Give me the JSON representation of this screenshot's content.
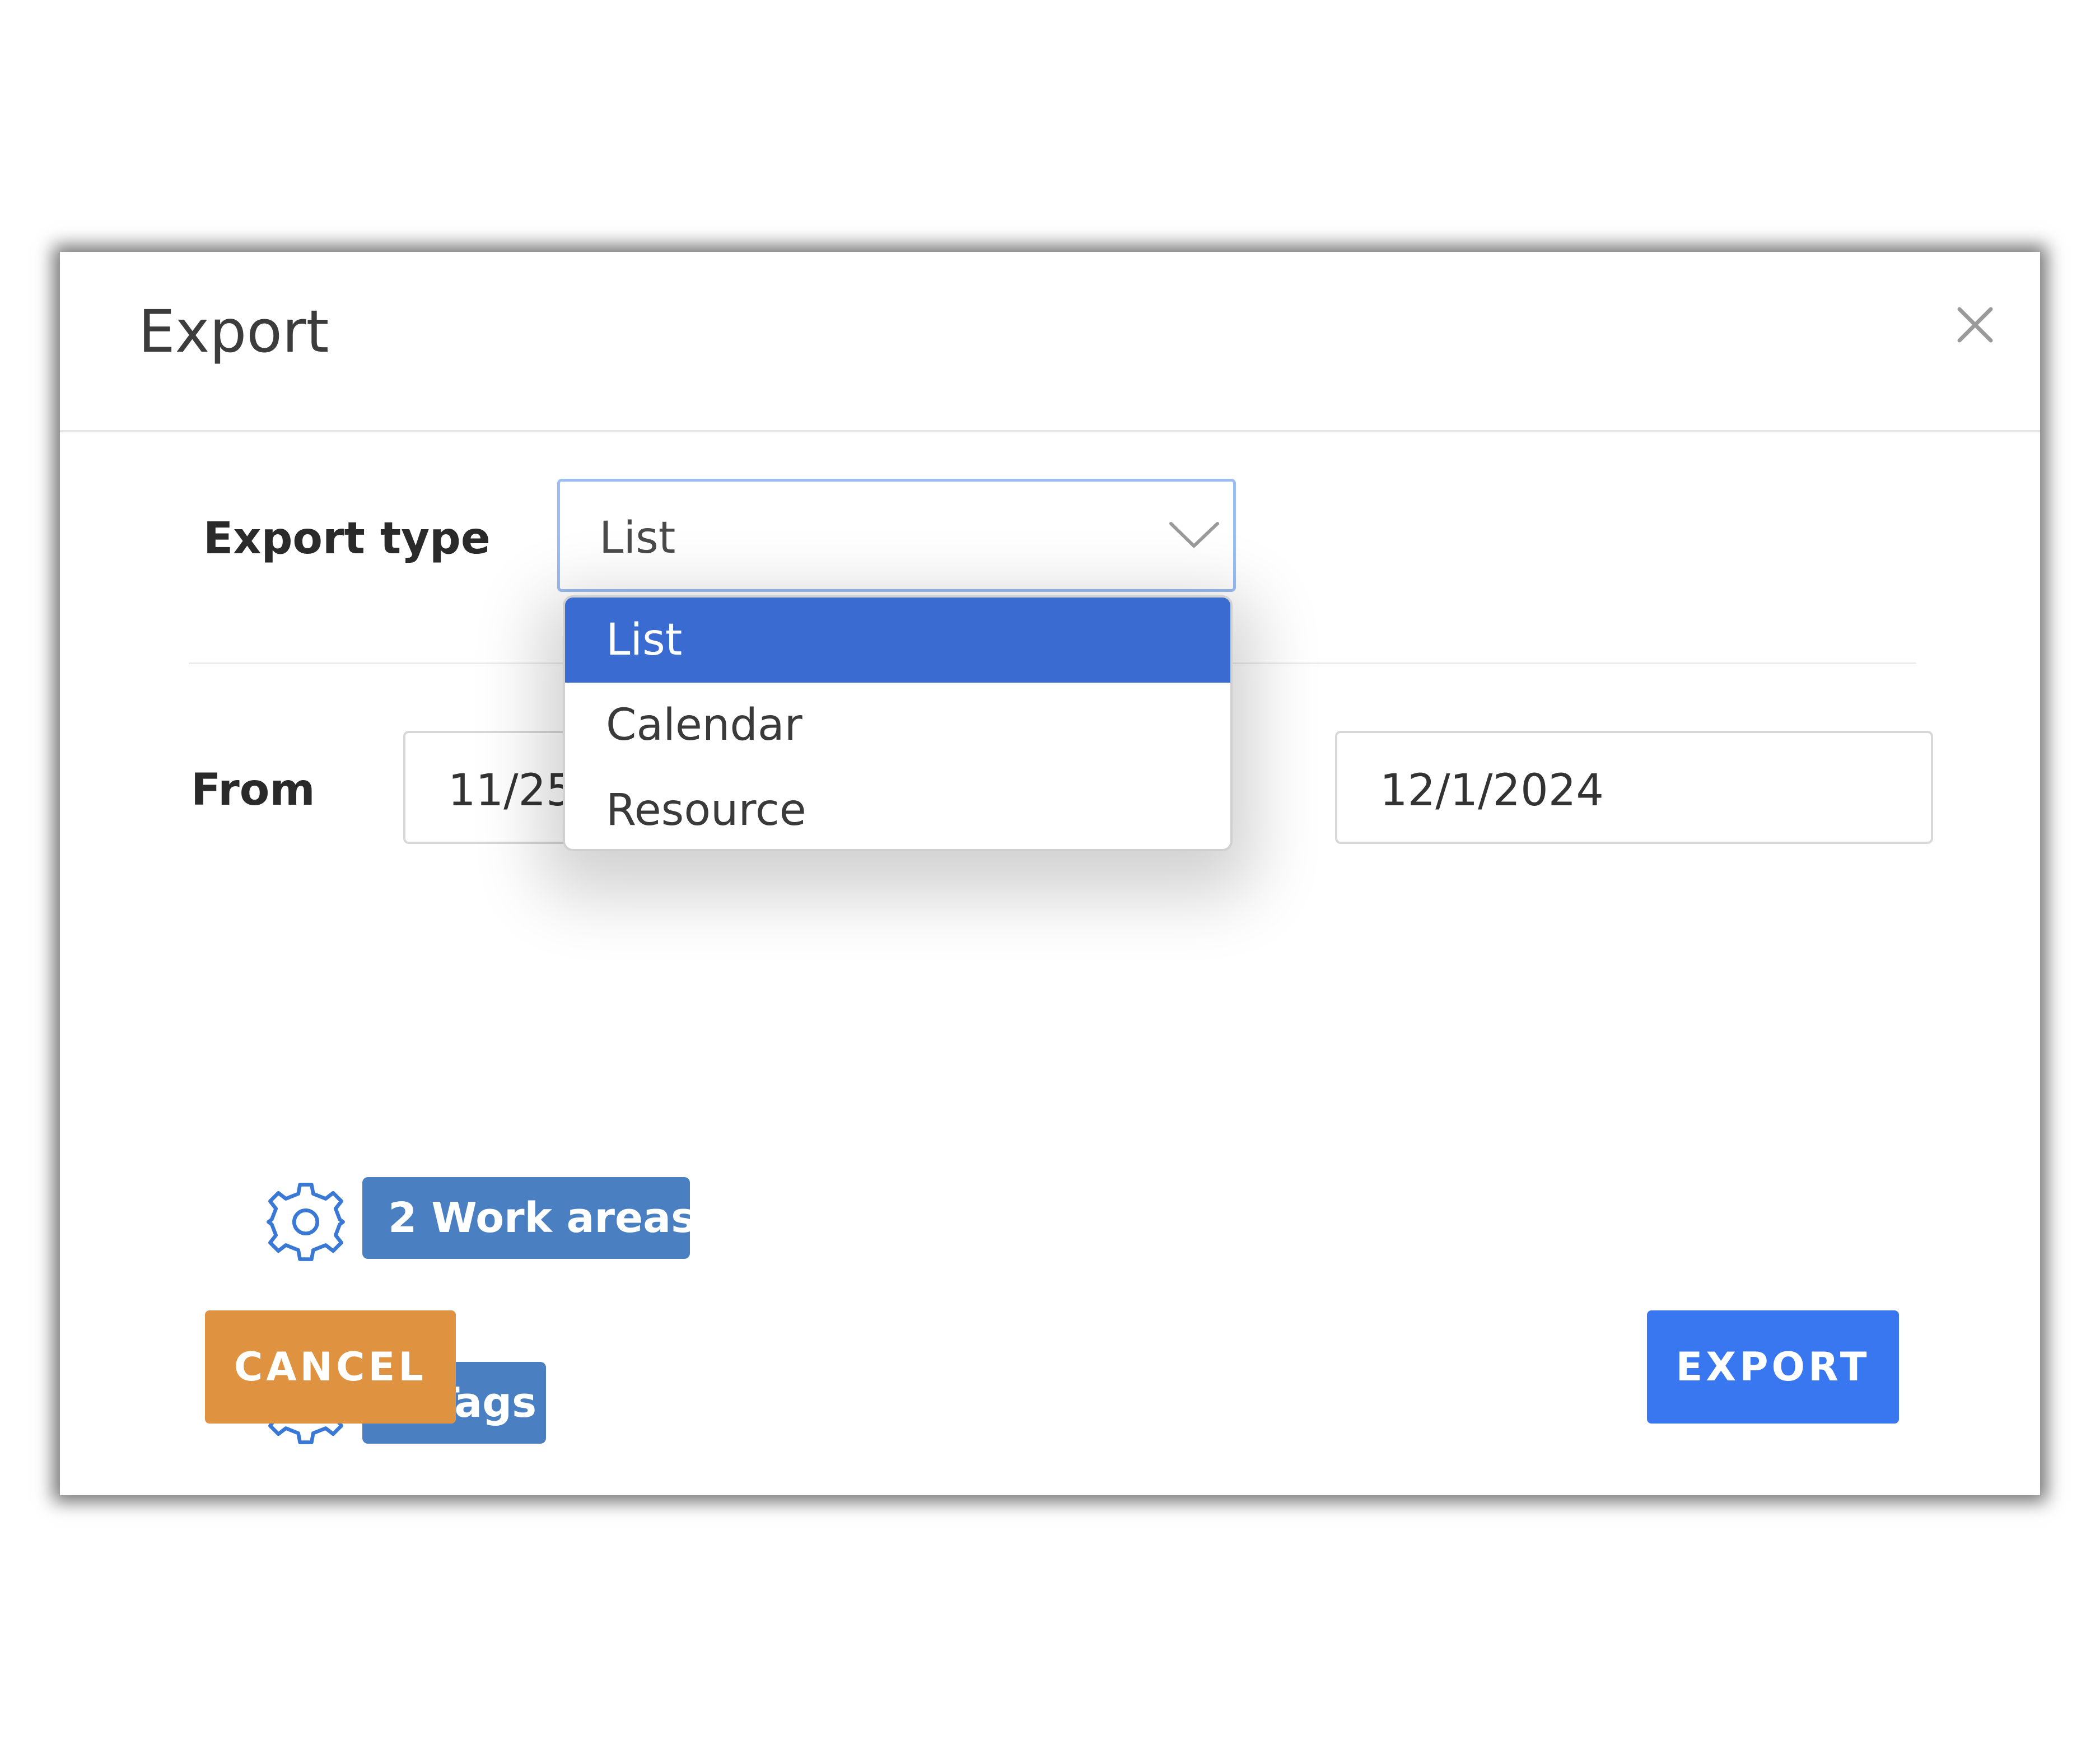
{
  "dialog": {
    "title": "Export",
    "close_icon": "close-icon"
  },
  "export_type": {
    "label": "Export type",
    "selected": "List",
    "options": [
      "List",
      "Calendar",
      "Resource"
    ],
    "highlighted_index": 0
  },
  "date_range": {
    "from_label": "From",
    "from_value": "11/25",
    "to_value": "12/1/2024"
  },
  "filters": {
    "work_areas": {
      "icon": "gear-icon",
      "badge": "2 Work areas"
    },
    "tags": {
      "icon": "gear-icon",
      "badge": "1 Tags"
    }
  },
  "actions": {
    "cancel_label": "CANCEL",
    "export_label": "EXPORT"
  },
  "colors": {
    "selected_option": "#3a6bd1",
    "badge": "#4a80c2",
    "cancel": "#df9340",
    "export": "#3877ef",
    "select_focus_border": "#9cbdf2"
  }
}
